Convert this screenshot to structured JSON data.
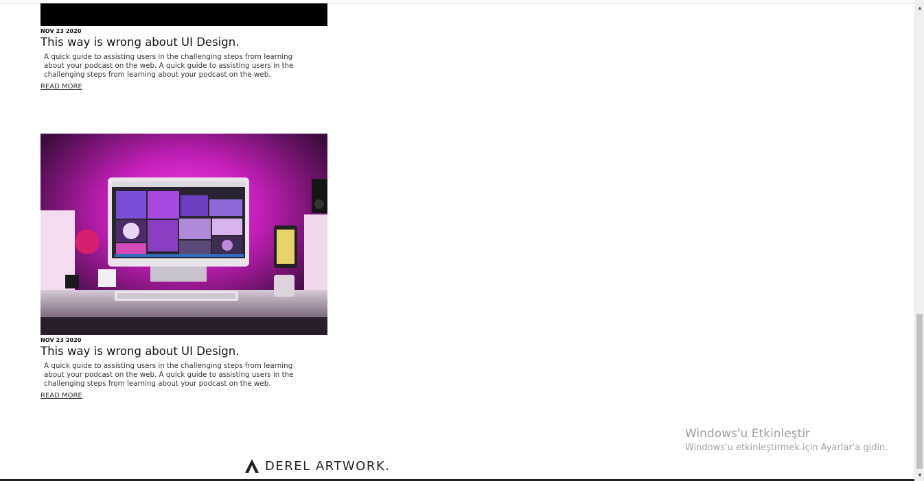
{
  "posts": [
    {
      "date": "NOV 23 2020",
      "title": "This way is wrong about UI Design.",
      "excerpt": "A quick guide to assisting users in the challenging steps from learning about your podcast on the web. A quick guide to assisting users in the challenging steps from learning about your podcast on the web.",
      "read_more": "READ MORE"
    },
    {
      "date": "NOV 23 2020",
      "title": "This way is wrong about UI Design.",
      "excerpt": "A quick guide to assisting users in the challenging steps from learning about your podcast on the web. A quick guide to assisting users in the challenging steps from learning about your podcast on the web.",
      "read_more": "READ MORE"
    }
  ],
  "footer": {
    "logo_text": "DEREL ARTWORK."
  },
  "watermark": {
    "title": "Windows'u Etkinleştir",
    "subtitle": "Windows'u etkinleştirmek için Ayarlar'a gidin."
  },
  "colors": {
    "accent_magenta": "#e52fd6",
    "text": "#111111",
    "background": "#ffffff"
  },
  "icons": {
    "scroll_up": "triangle-up",
    "scroll_down": "triangle-down",
    "logo_mark": "a-triangle"
  }
}
